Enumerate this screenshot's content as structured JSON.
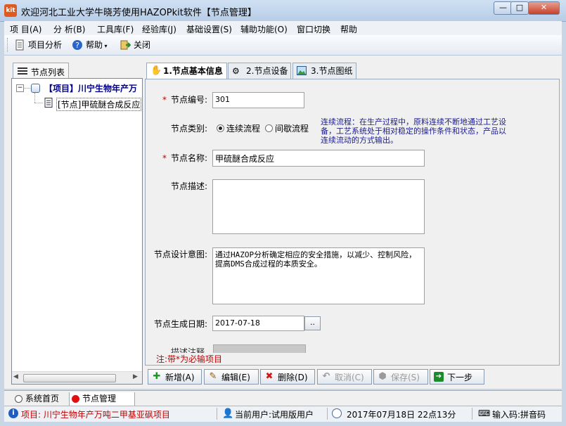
{
  "window": {
    "app_icon_text": "kit",
    "title": "欢迎河北工业大学牛晓芳使用HAZOPkit软件【节点管理】",
    "minimize": "—",
    "maximize": "□",
    "close": "✕"
  },
  "menu": [
    "项 目(A)",
    "分 析(B)",
    "工具库(F)",
    "经验库(J)",
    "基础设置(S)",
    "辅助功能(O)",
    "窗口切换",
    "帮助"
  ],
  "toolbar": {
    "project_analysis": "项目分析",
    "help": "帮助",
    "close": "关闭"
  },
  "left_panel": {
    "tab_label": "节点列表",
    "project_node": "【项目】川宁生物年产万",
    "child_node": "[节点]甲硫醚合成反应"
  },
  "tabs": [
    "1.节点基本信息",
    "2.节点设备",
    "3.节点图纸"
  ],
  "form": {
    "node_number_label": "节点编号:",
    "node_number_value": "301",
    "node_type_label": "节点类别:",
    "type_continuous": "连续流程",
    "type_batch": "间歇流程",
    "type_hint": "连续流程：在生产过程中，原料连续不断地通过工艺设备，工艺系统处于相对稳定的操作条件和状态，产品以连续流动的方式输出。",
    "node_name_label": "节点名称:",
    "node_name_value": "甲硫醚合成反应",
    "node_desc_label": "节点描述:",
    "node_desc_value": "",
    "design_intent_label": "节点设计意图:",
    "design_intent_value": "通过HAZOP分析确定相应的安全措施，以减少、控制风险，提高DMS合成过程的本质安全。",
    "date_label": "节点生成日期:",
    "date_value": "2017-07-18",
    "date_button": "..",
    "cutoff_label": "描述注释",
    "required_note": "注:带*为必输项目"
  },
  "actions": {
    "add": "新增(A)",
    "edit": "编辑(E)",
    "delete": "删除(D)",
    "cancel": "取消(C)",
    "save": "保存(S)",
    "next": "下一步"
  },
  "bottom_tabs": [
    "系统首页",
    "节点管理"
  ],
  "status": {
    "project": "项目: 川宁生物年产万吨二甲基亚砜项目",
    "user": "当前用户:试用版用户",
    "datetime": "2017年07月18日 22点13分",
    "ime": "输入码:拼音码"
  },
  "colors": {
    "required_star": "#c00000",
    "hint_text": "#1c1c8c",
    "status_project": "#c00000"
  }
}
